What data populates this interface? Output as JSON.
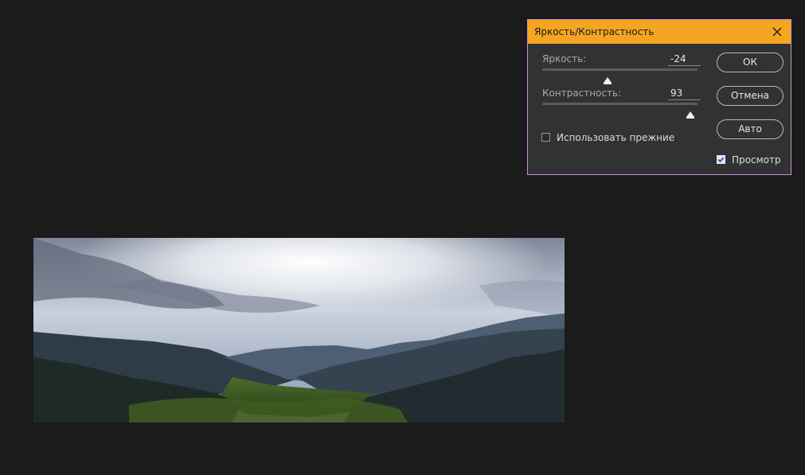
{
  "dialog": {
    "title": "Яркость/Контрастность",
    "brightness": {
      "label": "Яркость:",
      "value": "-24",
      "min": -150,
      "max": 150
    },
    "contrast": {
      "label": "Контрастность:",
      "value": "93",
      "min": -50,
      "max": 100
    },
    "use_legacy_label": "Использовать прежние",
    "use_legacy_checked": false,
    "buttons": {
      "ok": "ОК",
      "cancel": "Отмена",
      "auto": "Авто"
    },
    "preview_label": "Просмотр",
    "preview_checked": true
  },
  "colors": {
    "titlebar": "#f4a522",
    "dialog_bg": "#323232",
    "canvas_bg": "#1b1b1b",
    "dialog_border": "#c98fd6"
  },
  "icons": {
    "close": "close-icon",
    "check": "checkmark-icon",
    "slider_thumb": "triangle-up-icon"
  }
}
